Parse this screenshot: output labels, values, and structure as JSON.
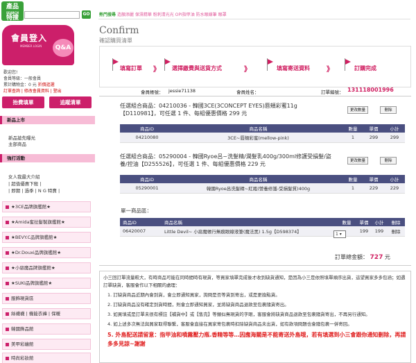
{
  "sidebar": {
    "logo_text": "產品",
    "logo_sub": "SEARCH",
    "logo_text2": "特搜",
    "search_button": "GO",
    "login_title": "會員登入",
    "login_sub": "MEMBER LOGIN",
    "qa_label": "Q&A",
    "welcome": "歡迎您!",
    "level_label": "會員等級：一般會員",
    "bonus_label": "累計購物金：0 元",
    "bonus_link": "折價逛選",
    "links_line": "訂單查詢 | 修改會員資料 | 登出",
    "pay_button": "抬費填單",
    "track_button": "追蹤清單",
    "new_section": "新品上市",
    "new_links": [
      "新品搶先曝光",
      "主部商品"
    ],
    "strong_section": "強打活動",
    "strong_links": [
      "女人我最大介紹",
      "| 超值優惠下殺 |",
      "| 即期 | 過季 | N G 特賣 |"
    ],
    "categories": [
      "★3CE品牌旗艦館★",
      "★Amida蜜拉髮製旗艦館★",
      "★BEVY.C品牌旗艦館★",
      "★Dr.Douxi品牌旗艦館★",
      "★小惡魔品牌旗艦館★",
      "★SUKI品牌旗艦館★",
      "服飾現貨區",
      "絲襪襪 | 機能衣褲 | 保暖",
      "韓國飾品館",
      "美甲彩繪館",
      "時尚彩妝館"
    ]
  },
  "topbar": {
    "hot_label": "熱門搜尋",
    "hot_keywords": "造顏添麗 保濕精華 粉刺清光光 OPI指甲油 防水眼線筆 眼罩"
  },
  "page": {
    "title": "Confirm",
    "subtitle": "確認購買清單"
  },
  "steps": [
    "填寫訂單",
    "選擇繳費與送貨方式",
    "填寫寄送資料",
    "訂購完成"
  ],
  "order_info": {
    "account_label": "會員帳號：",
    "account_value": "jessie71138",
    "name_label": "會員姓名：",
    "name_value": "",
    "order_no_label": "訂單編號：",
    "order_no_value": "131118001996"
  },
  "groups": [
    {
      "title": "任選組合商品：04210036 - 韓國3CE(3CONCEPT EYES)唇頰彩蜜11g【D110981】，可任選 1 件、每組優惠價格 299 元",
      "edit_btn": "更改數量",
      "delete_btn": "刪除",
      "headers": [
        "商品ID",
        "商品名稱",
        "數量",
        "單價",
        "小計"
      ],
      "rows": [
        [
          "04210080",
          "3CE~唇頰彩蜜(mellow-pink)",
          "1",
          "299",
          "299"
        ]
      ]
    },
    {
      "title": "任選組合商品：05290004 - 韓國Ryoe呂~洗髮精/潤髮乳400g/300ml修護受損髮/盜養/控油【D255526】，可任選 1 件、每組優惠價格 229 元",
      "edit_btn": "更改數量",
      "delete_btn": "刪除",
      "headers": [
        "商品ID",
        "商品名稱",
        "數量",
        "單價",
        "小計"
      ],
      "rows": [
        [
          "05290001",
          "韓國Ryoe呂洗髮精~紅瓶(營養修護-受損髮質)400g",
          "1",
          "229",
          "229"
        ]
      ]
    }
  ],
  "single": {
    "label": "單一商品區：",
    "headers": [
      "商品ID",
      "商品名稱",
      "數量",
      "單價",
      "小計",
      "刪除"
    ],
    "rows": [
      [
        "06420007",
        "Little Devil~ 小惡魔帳行無痕眼線液筆(魔法黑) 1.5g【D598374】",
        "1",
        "199",
        "199",
        "刪除"
      ]
    ]
  },
  "total": {
    "label": "訂單總金額：",
    "amount": "727",
    "unit": "元"
  },
  "notice": {
    "intro": "小三回訂單流量較大，有時商品可能在同時間時有現貨，等買家填單完成後才收到缺貨通知，是因為小三是依照填單順序出貨，這望買家多多包涵；如遇訂單缺貨，客服會作以下相關的處理：",
    "items": [
      "1. 訂缺貨商品近期內會到貨，會立即通知買家，詢問是否等貨到寄出，或是更換點貨。",
      "2. 訂缺貨商品沒有確定到貨時間，則會立即通知買家，並將缺貨商品退款至包裹隨貨寄出。",
      "3. 如買填或是訂單未很有標註【補貨中】或【售完】等類似無現貨的字眼，客服會將缺貨商品退款至包裹隨貨寄出，不再另行通知。",
      "4. 如上述多次無法與買家取得聯繫，客服會直接在買家寄包裹時扣除缺貨商品未出貨，如有款項問題也會隨包裹一併寄回。",
      "5. 外島配送請留意：指甲油和噴霧壓力瓶.香精等等…因應海關是不能寄送外島哦，若有填選到小三會跟你通知刪除，再請多多見諒~謝謝"
    ]
  }
}
